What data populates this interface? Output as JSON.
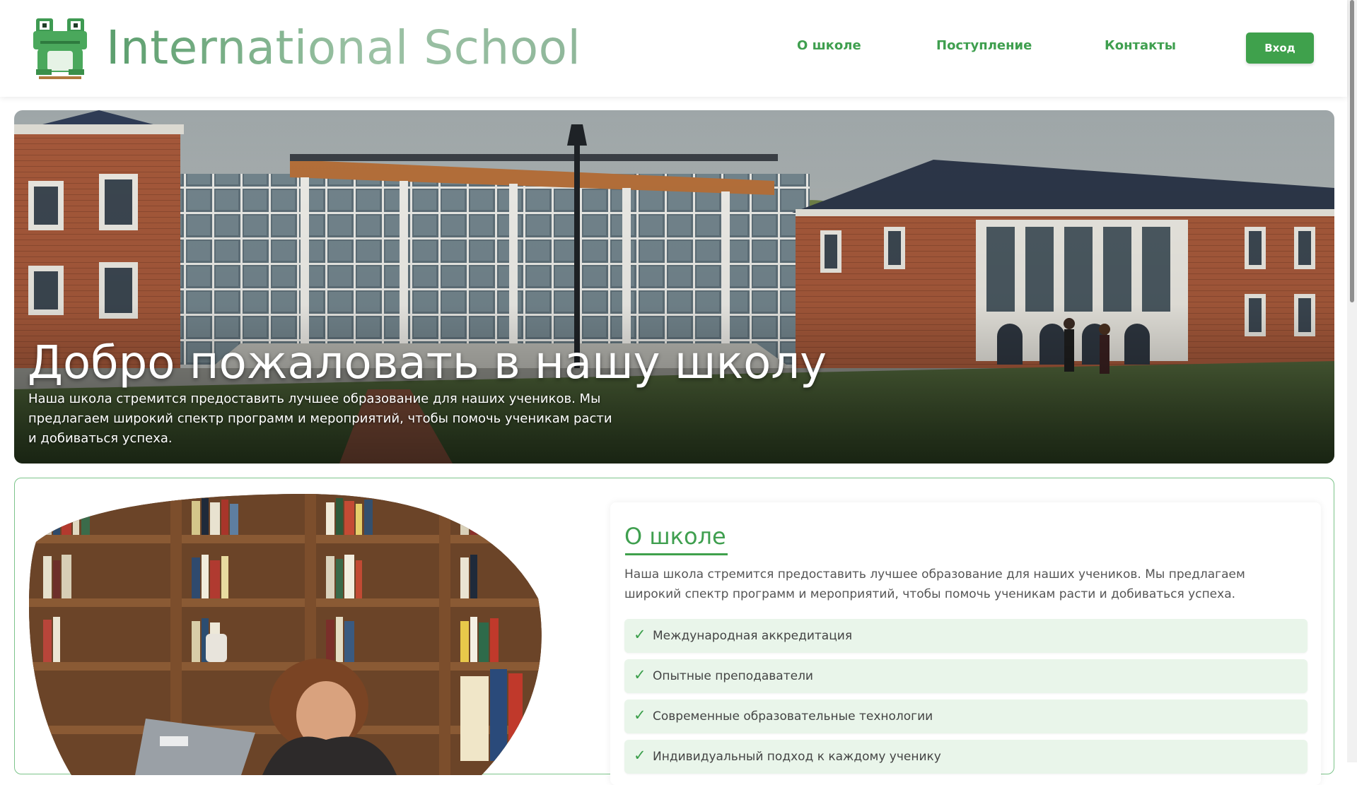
{
  "header": {
    "site_title": "International School",
    "nav": {
      "about": "О школе",
      "admission": "Поступление",
      "contacts": "Контакты"
    },
    "login_label": "Вход"
  },
  "hero": {
    "title": "Добро пожаловать в нашу школу",
    "text": "Наша школа стремится предоставить лучшее образование для наших учеников. Мы предлагаем широкий спектр программ и мероприятий, чтобы помочь ученикам расти и добиваться успеха."
  },
  "about": {
    "heading": "О школе",
    "text": "Наша школа стремится предоставить лучшее образование для наших учеников. Мы предлагаем широкий спектр программ и мероприятий, чтобы помочь ученикам расти и добиваться успеха.",
    "check_symbol": "✓",
    "features": [
      "Международная аккредитация",
      "Опытные преподаватели",
      "Современные образовательные технологии",
      "Индивидуальный подход к каждому ученику"
    ]
  },
  "colors": {
    "brand_green": "#3fa14c",
    "nav_green": "#3f9f4f",
    "feature_bg": "#e9f5ea",
    "section_border": "#7cc48a"
  },
  "icons": {
    "logo": "frog-logo-icon",
    "check": "check-icon"
  }
}
